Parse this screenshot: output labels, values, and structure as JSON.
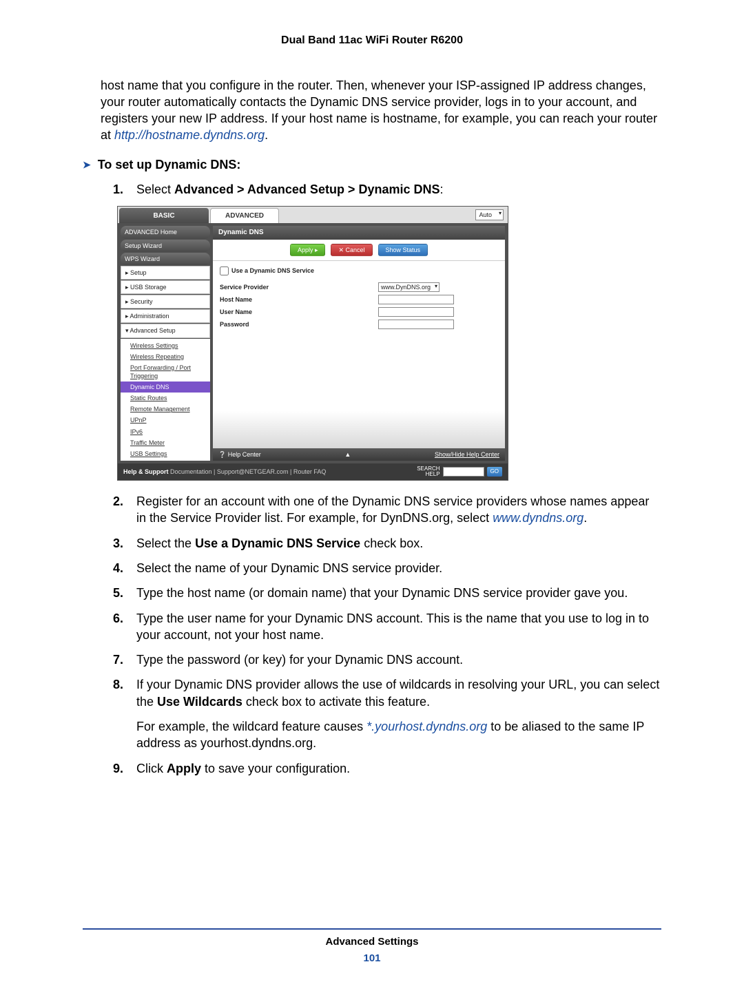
{
  "doc": {
    "header": "Dual Band 11ac WiFi Router R6200",
    "footer_section": "Advanced Settings",
    "page_number": "101"
  },
  "intro": {
    "text_a": "host name that you configure in the router. Then, whenever your ISP-assigned IP address changes, your router automatically contacts the Dynamic DNS service provider, logs in to your account, and registers your new IP address. If your host name is hostname, for example, you can reach your router at ",
    "link": "http://hostname.dyndns.org",
    "text_b": "."
  },
  "section_title": "To set up Dynamic DNS:",
  "steps": {
    "s1a": "Select ",
    "s1b": "Advanced > Advanced Setup > Dynamic DNS",
    "s1c": ":",
    "s2a": "Register for an account with one of the Dynamic DNS service providers whose names appear in the Service Provider list. For example, for DynDNS.org, select ",
    "s2link": "www.dyndns.org",
    "s2b": ".",
    "s3a": "Select the ",
    "s3b": "Use a Dynamic DNS Service",
    "s3c": " check box.",
    "s4": "Select the name of your Dynamic DNS service provider.",
    "s5": "Type the host name (or domain name) that your Dynamic DNS service provider gave you.",
    "s6": "Type the user name for your Dynamic DNS account. This is the name that you use to log in to your account, not your host name.",
    "s7": "Type the password (or key) for your Dynamic DNS account.",
    "s8a": "If your Dynamic DNS provider allows the use of wildcards in resolving your URL, you can select the ",
    "s8b": "Use Wildcards",
    "s8c": " check box to activate this feature.",
    "s8p_a": "For example, the wildcard feature causes ",
    "s8p_link": "*.yourhost.dyndns.org",
    "s8p_b": " to be aliased to the same IP address as yourhost.dyndns.org.",
    "s9a": "Click ",
    "s9b": "Apply",
    "s9c": " to save your configuration."
  },
  "shot": {
    "tab_basic": "BASIC",
    "tab_advanced": "ADVANCED",
    "auto": "Auto",
    "side": {
      "adv_home": "ADVANCED Home",
      "setup_wizard": "Setup Wizard",
      "wps_wizard": "WPS Wizard",
      "setup": "▸ Setup",
      "usb": "▸ USB Storage",
      "security": "▸ Security",
      "admin": "▸ Administration",
      "adv_setup": "▾ Advanced Setup",
      "sub": {
        "wireless": "Wireless Settings",
        "repeating": "Wireless Repeating",
        "portfwd": "Port Forwarding / Port Triggering",
        "ddns": "Dynamic DNS",
        "static": "Static Routes",
        "remote": "Remote Management",
        "upnp": "UPnP",
        "ipv6": "IPv6",
        "traffic": "Traffic Meter",
        "usbset": "USB Settings"
      }
    },
    "panel": {
      "title": "Dynamic DNS",
      "btn_apply": "Apply ▸",
      "btn_cancel": "✕ Cancel",
      "btn_status": "Show Status",
      "chk_label": "Use a Dynamic DNS Service",
      "svc_provider": "Service Provider",
      "svc_value": "www.DynDNS.org",
      "host_name": "Host Name",
      "user_name": "User Name",
      "password": "Password"
    },
    "helpbar": {
      "left": "❔ Help Center",
      "right": "Show/Hide Help Center"
    },
    "hs": {
      "label": "Help & Support",
      "links": " Documentation | Support@NETGEAR.com | Router FAQ",
      "search": "SEARCH HELP",
      "go": "GO"
    }
  }
}
